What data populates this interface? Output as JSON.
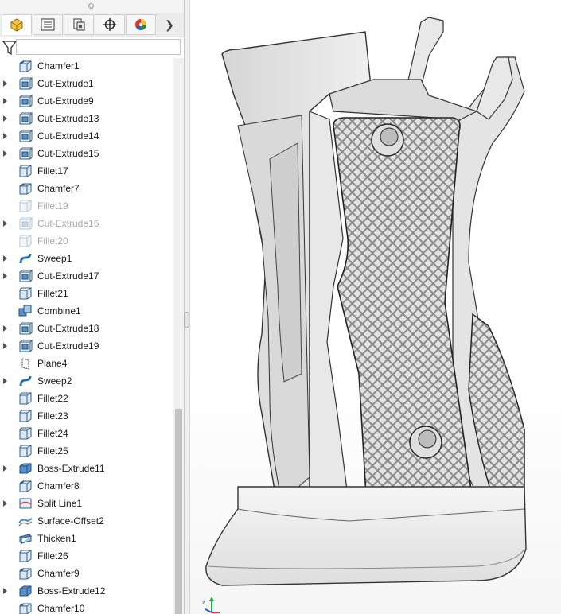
{
  "feature_tree": {
    "items": [
      {
        "label": "Chamfer1",
        "icon": "chamfer-icon",
        "expandable": false,
        "suppressed": false
      },
      {
        "label": "Cut-Extrude1",
        "icon": "cut-extrude-icon",
        "expandable": true,
        "suppressed": false
      },
      {
        "label": "Cut-Extrude9",
        "icon": "cut-extrude-icon",
        "expandable": true,
        "suppressed": false
      },
      {
        "label": "Cut-Extrude13",
        "icon": "cut-extrude-icon",
        "expandable": true,
        "suppressed": false
      },
      {
        "label": "Cut-Extrude14",
        "icon": "cut-extrude-icon",
        "expandable": true,
        "suppressed": false
      },
      {
        "label": "Cut-Extrude15",
        "icon": "cut-extrude-icon",
        "expandable": true,
        "suppressed": false
      },
      {
        "label": "Fillet17",
        "icon": "fillet-icon",
        "expandable": false,
        "suppressed": false
      },
      {
        "label": "Chamfer7",
        "icon": "chamfer-icon",
        "expandable": false,
        "suppressed": false
      },
      {
        "label": "Fillet19",
        "icon": "fillet-icon",
        "expandable": false,
        "suppressed": true
      },
      {
        "label": "Cut-Extrude16",
        "icon": "cut-extrude-icon",
        "expandable": true,
        "suppressed": true
      },
      {
        "label": "Fillet20",
        "icon": "fillet-icon",
        "expandable": false,
        "suppressed": true
      },
      {
        "label": "Sweep1",
        "icon": "sweep-icon",
        "expandable": true,
        "suppressed": false
      },
      {
        "label": "Cut-Extrude17",
        "icon": "cut-extrude-icon",
        "expandable": true,
        "suppressed": false
      },
      {
        "label": "Fillet21",
        "icon": "fillet-icon",
        "expandable": false,
        "suppressed": false
      },
      {
        "label": "Combine1",
        "icon": "combine-icon",
        "expandable": false,
        "suppressed": false
      },
      {
        "label": "Cut-Extrude18",
        "icon": "cut-extrude-icon",
        "expandable": true,
        "suppressed": false
      },
      {
        "label": "Cut-Extrude19",
        "icon": "cut-extrude-icon",
        "expandable": true,
        "suppressed": false
      },
      {
        "label": "Plane4",
        "icon": "plane-icon",
        "expandable": false,
        "suppressed": false
      },
      {
        "label": "Sweep2",
        "icon": "sweep-icon",
        "expandable": true,
        "suppressed": false
      },
      {
        "label": "Fillet22",
        "icon": "fillet-icon",
        "expandable": false,
        "suppressed": false
      },
      {
        "label": "Fillet23",
        "icon": "fillet-icon",
        "expandable": false,
        "suppressed": false
      },
      {
        "label": "Fillet24",
        "icon": "fillet-icon",
        "expandable": false,
        "suppressed": false
      },
      {
        "label": "Fillet25",
        "icon": "fillet-icon",
        "expandable": false,
        "suppressed": false
      },
      {
        "label": "Boss-Extrude11",
        "icon": "boss-extrude-icon",
        "expandable": true,
        "suppressed": false
      },
      {
        "label": "Chamfer8",
        "icon": "chamfer-icon",
        "expandable": false,
        "suppressed": false
      },
      {
        "label": "Split Line1",
        "icon": "split-line-icon",
        "expandable": true,
        "suppressed": false
      },
      {
        "label": "Surface-Offset2",
        "icon": "surface-offset-icon",
        "expandable": false,
        "suppressed": false
      },
      {
        "label": "Thicken1",
        "icon": "thicken-icon",
        "expandable": false,
        "suppressed": false
      },
      {
        "label": "Fillet26",
        "icon": "fillet-icon",
        "expandable": false,
        "suppressed": false
      },
      {
        "label": "Chamfer9",
        "icon": "chamfer-icon",
        "expandable": false,
        "suppressed": false
      },
      {
        "label": "Boss-Extrude12",
        "icon": "boss-extrude-icon",
        "expandable": true,
        "suppressed": false
      },
      {
        "label": "Chamfer10",
        "icon": "chamfer-icon",
        "expandable": false,
        "suppressed": false
      }
    ]
  },
  "tabs": [
    {
      "icon": "feature-manager-icon",
      "active": true
    },
    {
      "icon": "property-manager-icon",
      "active": false
    },
    {
      "icon": "configuration-manager-icon",
      "active": false
    },
    {
      "icon": "dimxpert-manager-icon",
      "active": false
    },
    {
      "icon": "display-manager-icon",
      "active": false
    }
  ],
  "colors": {
    "feature_blue": "#3b8fd0",
    "tree_text": "#1a1a1a",
    "suppressed_text": "#a8a8a8"
  }
}
